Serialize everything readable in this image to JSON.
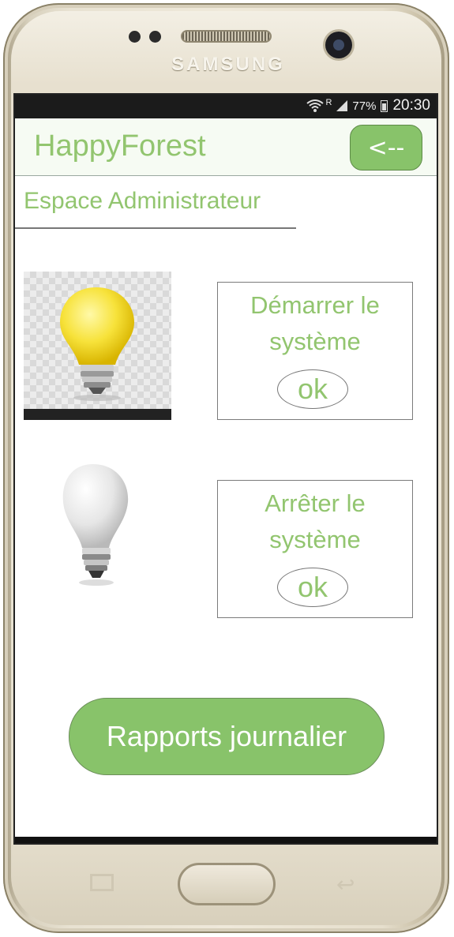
{
  "device": {
    "brand": "SAMSUNG"
  },
  "statusbar": {
    "battery": "77%",
    "time": "20:30",
    "signal_badge": "R"
  },
  "appbar": {
    "title": "HappyForest",
    "back_label": "<--"
  },
  "section": {
    "title": "Espace Administrateur"
  },
  "controls": [
    {
      "text_line1": "Démarrer le",
      "text_line2": "système",
      "ok_label": "ok",
      "icon": "bulb-on-icon"
    },
    {
      "text_line1": "Arrêter le",
      "text_line2": "système",
      "ok_label": "ok",
      "icon": "bulb-off-icon"
    }
  ],
  "report_button": {
    "label": "Rapports journalier"
  },
  "colors": {
    "accent": "#88c36a",
    "text_green": "#92c56f"
  }
}
